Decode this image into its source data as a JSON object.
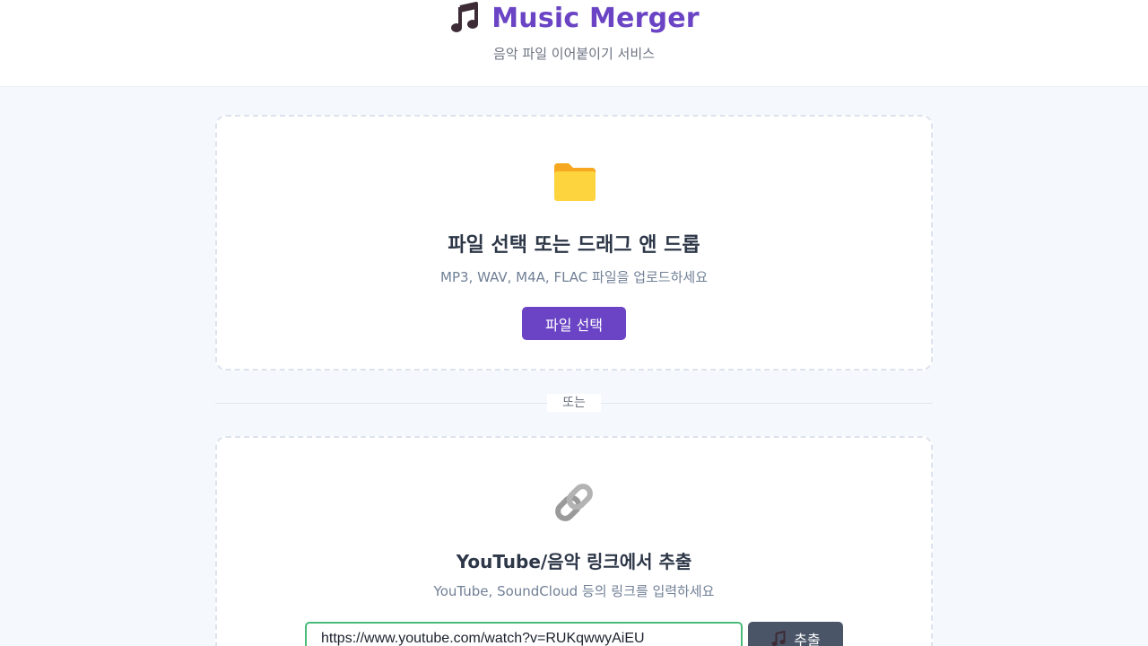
{
  "header": {
    "title": "Music Merger",
    "subtitle": "음악 파일 이어붙이기 서비스",
    "icon": "music-note-icon"
  },
  "upload": {
    "icon": "folder-icon",
    "title": "파일 선택 또는 드래그 앤 드롭",
    "description": "MP3, WAV, M4A, FLAC 파일을 업로드하세요",
    "button_label": "파일 선택"
  },
  "divider": {
    "label": "또는"
  },
  "link_extract": {
    "icon": "link-icon",
    "title": "YouTube/음악 링크에서 추출",
    "description": "YouTube, SoundCloud 등의 링크를 입력하세요",
    "input_value": "https://www.youtube.com/watch?v=RUKqwwyAiEU",
    "button_label": "추출",
    "button_icon": "music-note-icon"
  },
  "colors": {
    "brand": "#6a44c4",
    "folder": "#f6c23e",
    "input_border": "#48bb78",
    "extract_button": "#4a5568"
  }
}
